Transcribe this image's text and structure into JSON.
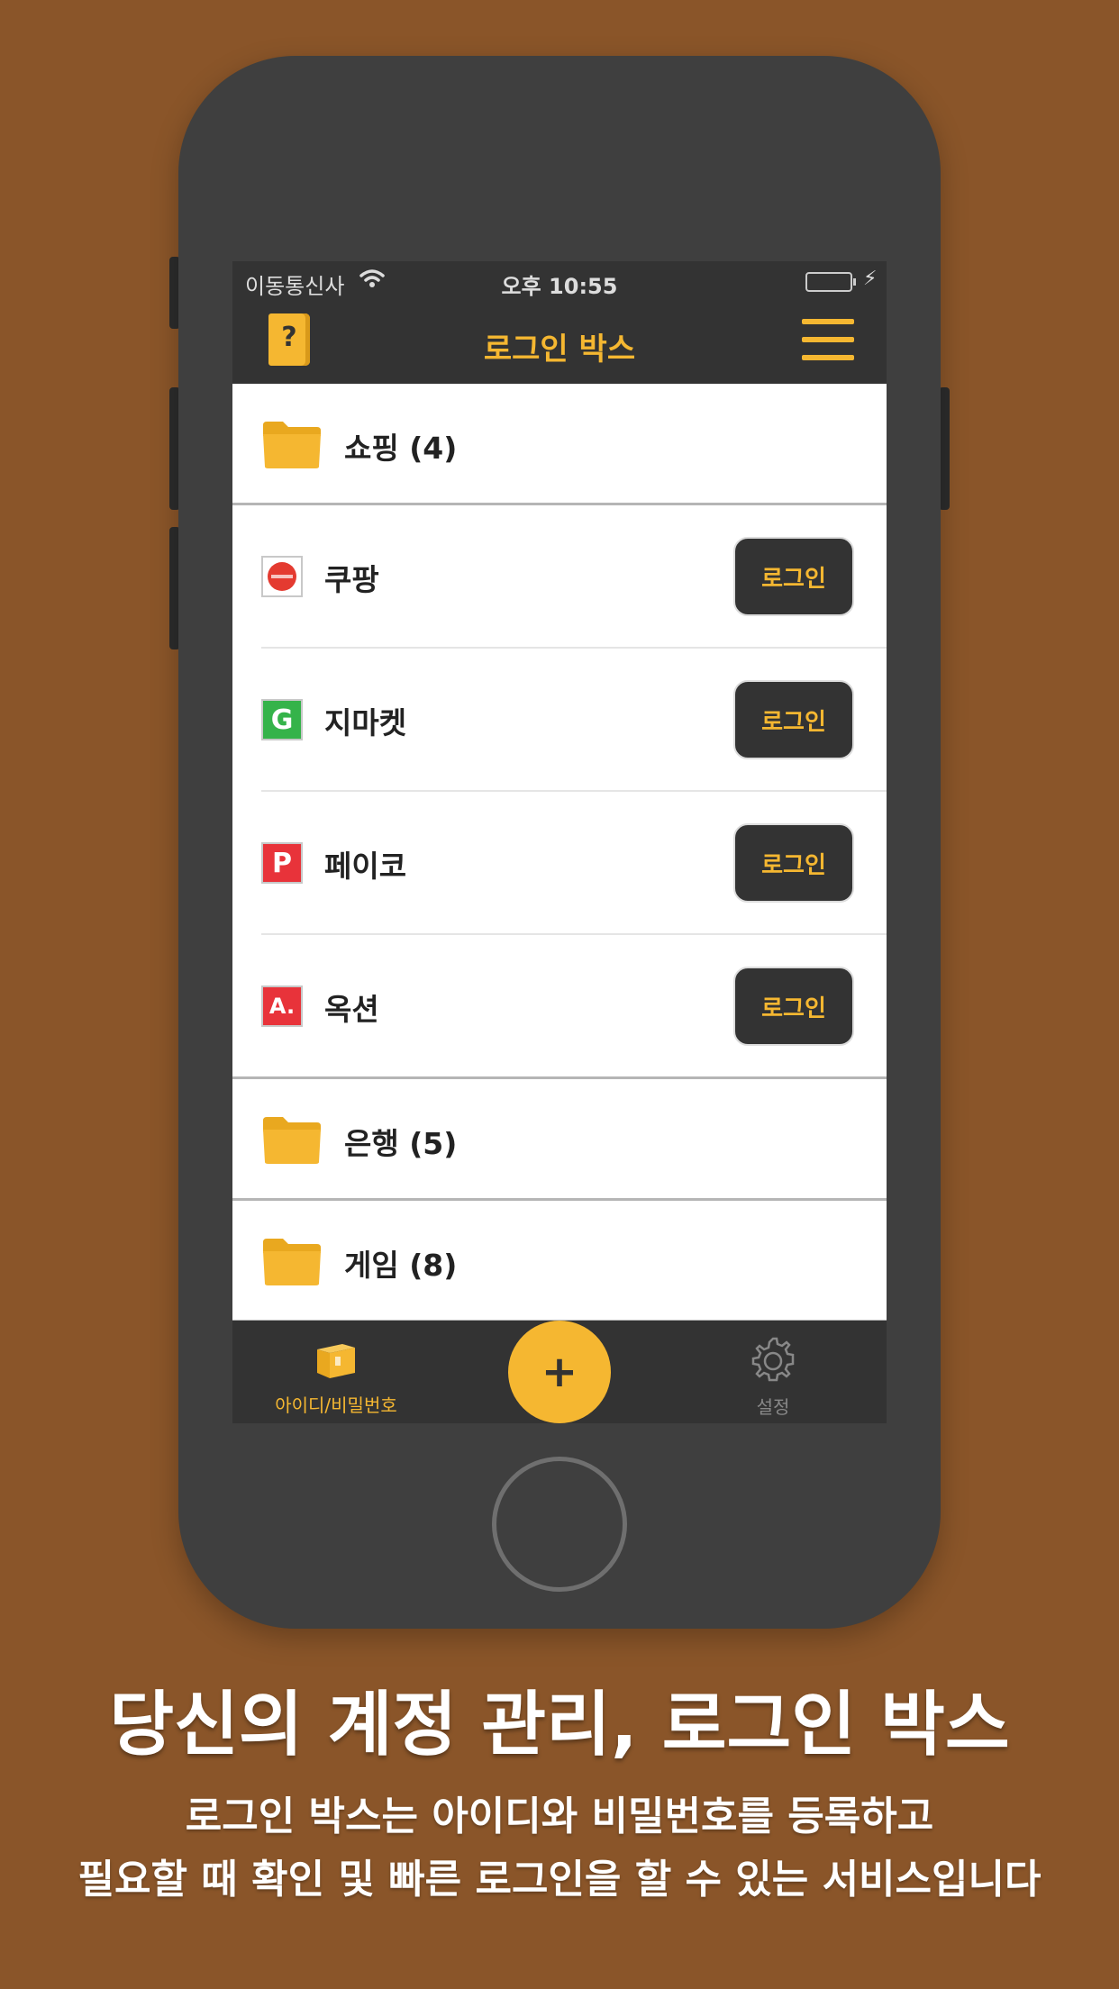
{
  "status_bar": {
    "carrier": "이동통신사",
    "time": "오후 10:55"
  },
  "nav": {
    "title": "로그인 박스",
    "help_mark": "?"
  },
  "folders": [
    {
      "label": "쇼핑 (4)"
    },
    {
      "label": "은행 (5)"
    },
    {
      "label": "게임 (8)"
    }
  ],
  "sites": [
    {
      "name": "쿠팡",
      "button": "로그인",
      "icon_color": "#e43a30"
    },
    {
      "name": "지마켓",
      "button": "로그인",
      "icon_color": "#35b34a"
    },
    {
      "name": "페이코",
      "button": "로그인",
      "icon_color": "#e8333a"
    },
    {
      "name": "옥션",
      "button": "로그인",
      "icon_color": "#e8333a"
    }
  ],
  "site_icon_glyphs": {
    "gmarket": "G",
    "payco": "P",
    "auction": "A."
  },
  "tab_bar": {
    "ids_label": "아이디/비밀번호",
    "add_symbol": "+",
    "settings_label": "설정"
  },
  "promo": {
    "headline": "당신의 계정 관리, 로그인 박스",
    "line1": "로그인 박스는 아이디와 비밀번호를 등록하고",
    "line2": "필요할 때 확인 및 빠른 로그인을 할 수 있는 서비스입니다"
  },
  "colors": {
    "accent": "#f5b731",
    "background": "#8a5529",
    "bar": "#333333"
  }
}
